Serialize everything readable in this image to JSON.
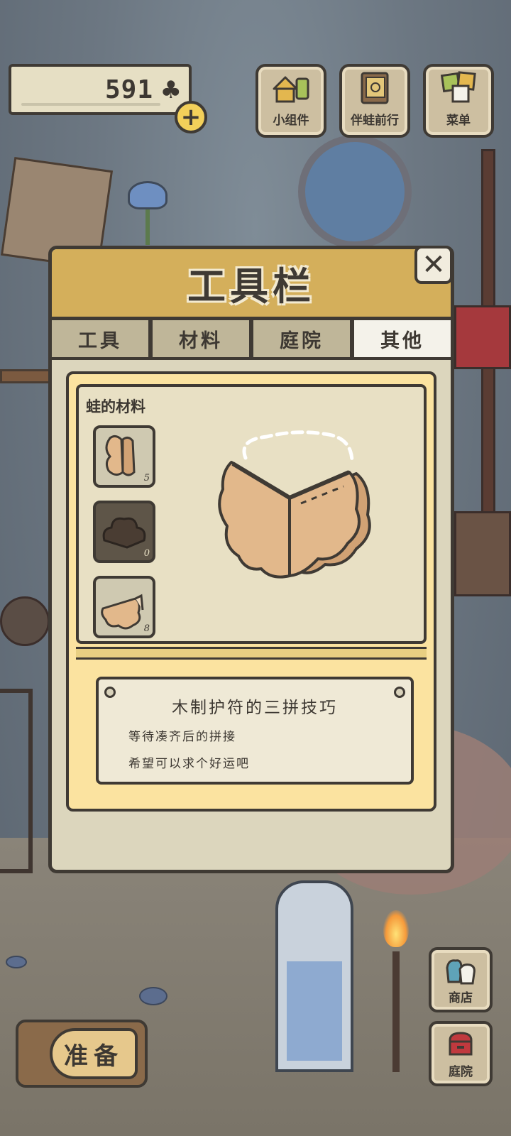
{
  "hud": {
    "clover_count": "591",
    "clover_icon": "clover-icon",
    "plus_icon": "plus-icon",
    "buttons": [
      {
        "label": "小组件",
        "icon": "widget-icon"
      },
      {
        "label": "伴蛙前行",
        "icon": "book-icon"
      },
      {
        "label": "菜单",
        "icon": "menu-cards-icon"
      }
    ]
  },
  "panel": {
    "title": "工具栏",
    "close_glyph": "✕",
    "tabs": [
      {
        "label": "工具",
        "active": false
      },
      {
        "label": "材料",
        "active": false
      },
      {
        "label": "庭院",
        "active": false
      },
      {
        "label": "其他",
        "active": true
      }
    ],
    "category": "蛙的材料",
    "items": [
      {
        "count": "5",
        "icon": "light-wood-pieces-icon",
        "selected": false
      },
      {
        "count": "0",
        "icon": "dark-wood-piece-icon",
        "selected": true
      },
      {
        "count": "8",
        "icon": "wood-charm-pieces-icon",
        "selected": false
      }
    ],
    "preview_icon": "wooden-charm-icon",
    "description": {
      "title": "木制护符的三拼技巧",
      "lines": [
        "等待凑齐后的拼接",
        "希望可以求个好运吧"
      ]
    }
  },
  "side_buttons": [
    {
      "label": "商店",
      "icon": "shop-bags-icon"
    },
    {
      "label": "庭院",
      "icon": "garden-mailbox-icon"
    }
  ],
  "prepare_button": {
    "label": "准备"
  },
  "colors": {
    "panel_header": "#d4af5b",
    "panel_body": "#dcd6bd",
    "content_frame": "#fbe3a0",
    "outline": "#3f3a34",
    "wood_light": "#e2b88b",
    "active_tab": "#f4f2ea"
  }
}
